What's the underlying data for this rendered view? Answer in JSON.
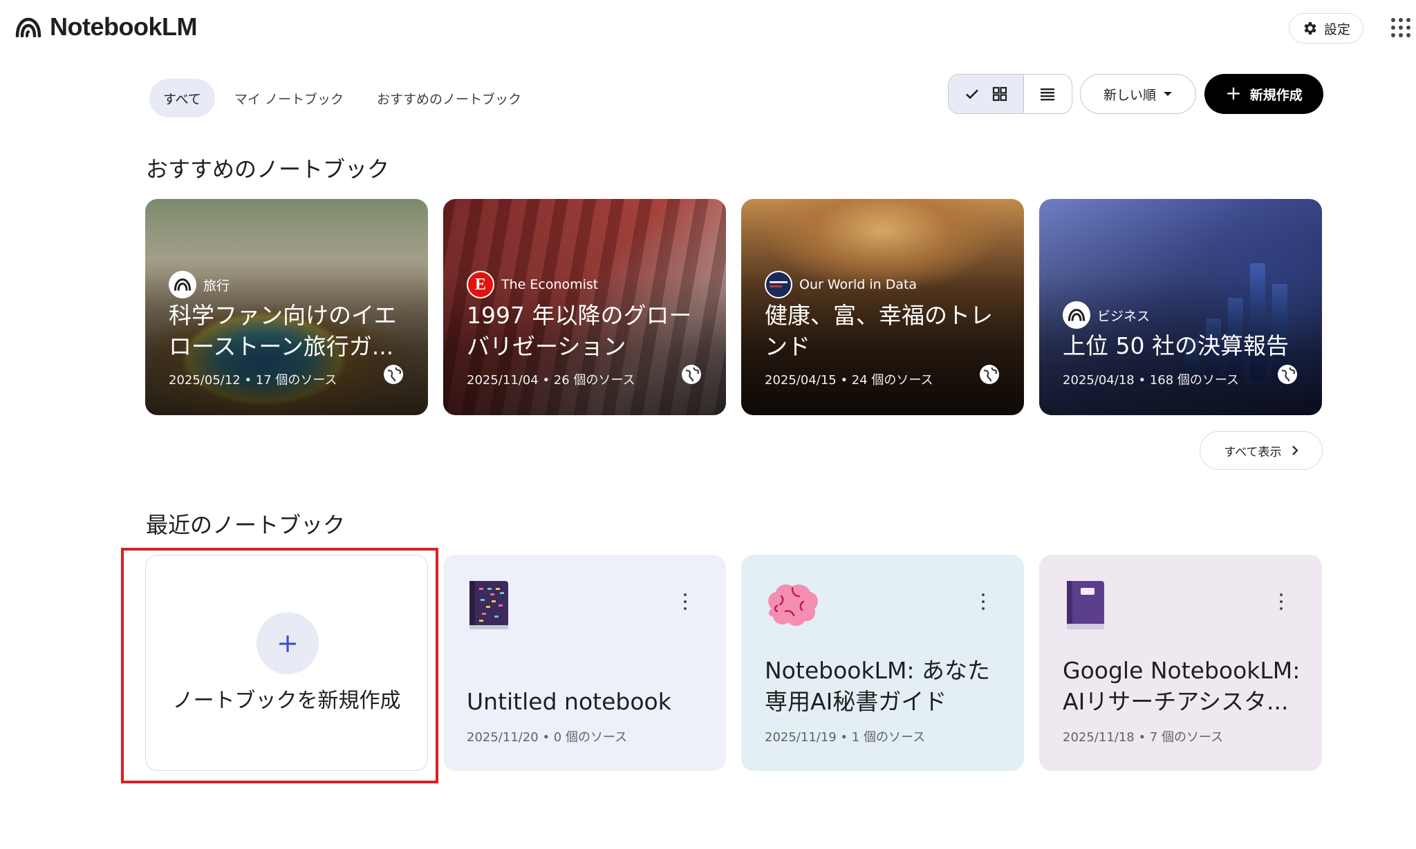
{
  "app": {
    "name": "NotebookLM"
  },
  "header": {
    "settings_label": "設定"
  },
  "tabs": [
    {
      "label": "すべて",
      "active": true
    },
    {
      "label": "マイ ノートブック",
      "active": false
    },
    {
      "label": "おすすめのノートブック",
      "active": false
    }
  ],
  "toolbar": {
    "view_mode": "grid",
    "sort_label": "新しい順",
    "new_label": "新規作成"
  },
  "featured": {
    "title": "おすすめのノートブック",
    "show_all_label": "すべて表示",
    "cards": [
      {
        "source": "旅行",
        "title": "科学ファン向けのイエローストーン旅行ガ...",
        "meta": "2025/05/12 • 17 個のソース",
        "icon": "notebooklm-logo"
      },
      {
        "source": "The Economist",
        "title": "1997 年以降のグローバリゼーション",
        "meta": "2025/11/04 • 26 個のソース",
        "icon": "economist-logo"
      },
      {
        "source": "Our World in Data",
        "title": "健康、富、幸福のトレンド",
        "meta": "2025/04/15 • 24 個のソース",
        "icon": "owid-logo"
      },
      {
        "source": "ビジネス",
        "title": "上位 50 社の決算報告",
        "meta": "2025/04/18 • 168 個のソース",
        "icon": "notebooklm-logo"
      }
    ]
  },
  "recent": {
    "title": "最近のノートブック",
    "create_label": "ノートブックを新規作成",
    "cards": [
      {
        "title": "Untitled notebook",
        "meta": "2025/11/20 • 0 個のソース",
        "icon": "notebook-emoji-icon"
      },
      {
        "title": "NotebookLM: あなた専用AI秘書ガイド",
        "meta": "2025/11/19 • 1 個のソース",
        "icon": "brain-emoji-icon"
      },
      {
        "title": "Google NotebookLM: AIリサーチアシスタ...",
        "meta": "2025/11/18 • 7 個のソース",
        "icon": "book-emoji-icon"
      }
    ]
  },
  "colors": {
    "primary_button": "#000000",
    "active_tab_bg": "#e8eaf6",
    "highlight_border": "#d81f26"
  }
}
